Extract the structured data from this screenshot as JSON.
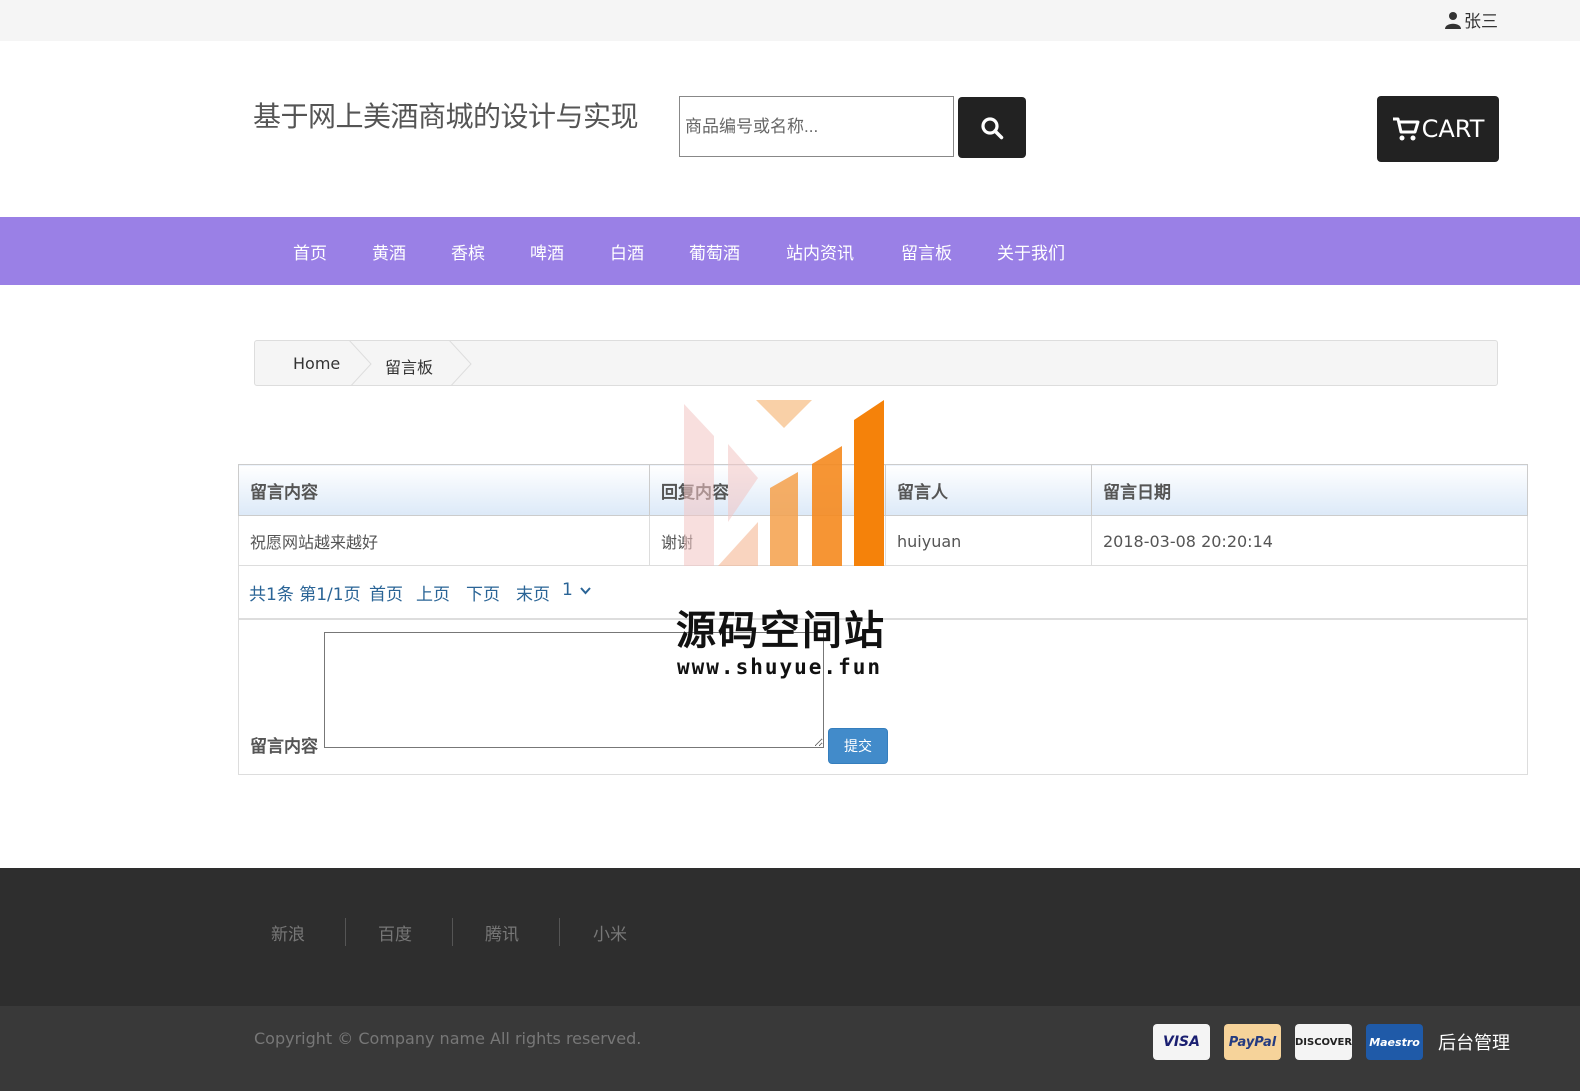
{
  "header": {
    "user_name": "张三",
    "site_title": "基于网上美酒商城的设计与实现",
    "search_placeholder": "商品编号或名称...",
    "cart_label": "CART"
  },
  "nav": [
    "首页",
    "黄酒",
    "香槟",
    "啤酒",
    "白酒",
    "葡萄酒",
    "站内资讯",
    "留言板",
    "关于我们"
  ],
  "breadcrumb": [
    "Home",
    "留言板"
  ],
  "table": {
    "headers": [
      "留言内容",
      "回复内容",
      "留言人",
      "留言日期"
    ],
    "rows": [
      [
        "祝愿网站越来越好",
        "谢谢",
        "huiyuan",
        "2018-03-08 20:20:14"
      ]
    ]
  },
  "pager": {
    "summary": "共1条 第1/1页",
    "first": "首页",
    "prev": "上页",
    "next": "下页",
    "last": "末页",
    "page": "1"
  },
  "form": {
    "label": "留言内容",
    "submit": "提交"
  },
  "watermark": {
    "title": "源码空间站",
    "url": "www.shuyue.fun"
  },
  "footer": {
    "links": [
      "新浪",
      "百度",
      "腾讯",
      "小米"
    ],
    "copyright": "Copyright © Company name All rights reserved.",
    "cards": [
      "VISA",
      "PayPal",
      "DISCOVER",
      "Maestro"
    ],
    "admin": "后台管理"
  }
}
